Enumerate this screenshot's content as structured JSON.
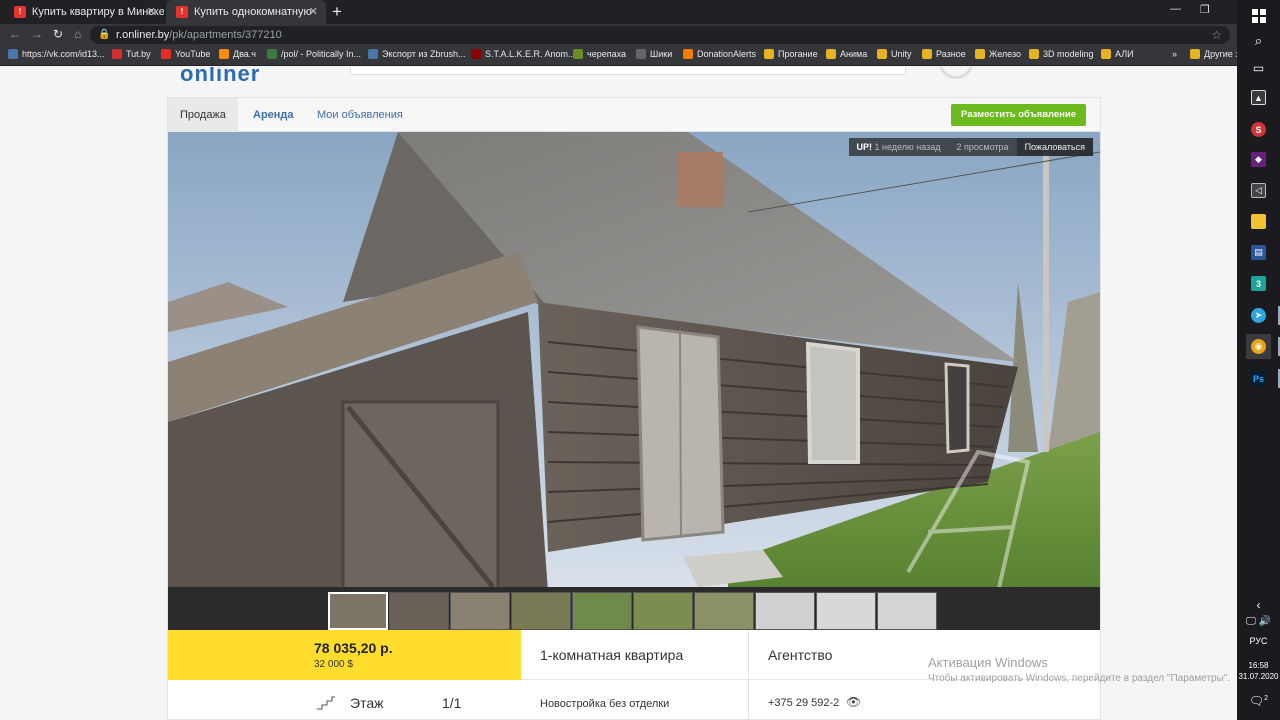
{
  "browser": {
    "tabs": [
      {
        "title": "Купить квартиру в Минске",
        "active": false
      },
      {
        "title": "Купить однокомнатную квартир",
        "active": true
      }
    ],
    "url_host": "r.onliner.by",
    "url_path": "/pk/apartments/377210",
    "bookmarks": [
      {
        "label": "https://vk.com/id13...",
        "icon": "vk-icon",
        "color": "#4a76a8"
      },
      {
        "label": "Tut.by",
        "icon": "tutby-icon",
        "color": "#d32f2f"
      },
      {
        "label": "YouTube",
        "icon": "youtube-icon",
        "color": "#e52d27"
      },
      {
        "label": "Два.ч",
        "icon": "dvach-icon",
        "color": "#ff8c00"
      },
      {
        "label": "/pol/ - Politically In...",
        "icon": "pol-icon",
        "color": "#3a7a3a"
      },
      {
        "label": "Экспорт из Zbrush...",
        "icon": "vk-icon",
        "color": "#4a76a8"
      },
      {
        "label": "S.T.A.L.K.E.R. Anom...",
        "icon": "stalker-icon",
        "color": "#8b0000"
      },
      {
        "label": "черепаха",
        "icon": "turtle-icon",
        "color": "#6b8e23"
      },
      {
        "label": "Шики",
        "icon": "shiki-icon",
        "color": "#666"
      },
      {
        "label": "DonationAlerts",
        "icon": "donationalerts-icon",
        "color": "#f57c00"
      },
      {
        "label": "Прогание",
        "icon": "folder-icon",
        "color": "#e6b422"
      },
      {
        "label": "Анима",
        "icon": "folder-icon",
        "color": "#e6b422"
      },
      {
        "label": "Unity",
        "icon": "folder-icon",
        "color": "#e6b422"
      },
      {
        "label": "Разное",
        "icon": "folder-icon",
        "color": "#e6b422"
      },
      {
        "label": "Железо",
        "icon": "folder-icon",
        "color": "#e6b422"
      },
      {
        "label": "3D modeling",
        "icon": "folder-icon",
        "color": "#e6b422"
      },
      {
        "label": "АЛИ",
        "icon": "folder-icon",
        "color": "#e6b422"
      }
    ],
    "bookmarks_more": "»",
    "other_bookmarks": "Другие з"
  },
  "page": {
    "tabs": [
      "Продажа",
      "Аренда",
      "Мои объявления"
    ],
    "post_button": "Разместить объявление",
    "stats": {
      "up": "UP!",
      "up_time": "1 неделю назад",
      "views": "2 просмотра",
      "report": "Пожаловаться"
    },
    "thumbnail_count": 10,
    "price_byn": "78 035,20 р.",
    "price_usd": "32 000 $",
    "rooms": "1-комнатная квартира",
    "seller": "Агентство",
    "floor_label": "Этаж",
    "floor_value": "1/1",
    "building": "Новостройка без отделки",
    "phone": "+375 29 592-2",
    "accent_color": "#fedd2d",
    "button_color": "#6cba1e"
  },
  "activation": {
    "title": "Активация Windows",
    "text": "Чтобы активировать Windows, перейдите в раздел \"Параметры\"."
  },
  "taskbar": {
    "lang": "РУС",
    "time": "16:58",
    "date": "31.07.2020",
    "notifications": "2"
  }
}
